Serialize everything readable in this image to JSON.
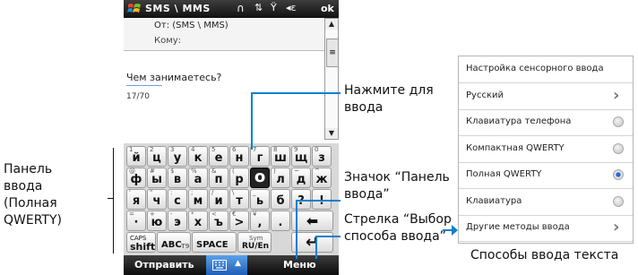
{
  "statusbar": {
    "title": "SMS \\ MMS",
    "ok": "ok"
  },
  "header": {
    "from": "От: (SMS \\ MMS)",
    "to": "Кому:"
  },
  "message": {
    "text": "Чем занимаетесь?",
    "counter": "17/70"
  },
  "keyboard": {
    "rows": [
      [
        {
          "s": "1",
          "m": "й"
        },
        {
          "s": "2",
          "m": "ц"
        },
        {
          "s": "3",
          "m": "у"
        },
        {
          "s": "4",
          "m": "к"
        },
        {
          "s": "5",
          "m": "е"
        },
        {
          "s": "6",
          "m": "н"
        },
        {
          "s": "7",
          "m": "г"
        },
        {
          "s": "8",
          "m": "ш"
        },
        {
          "s": "9",
          "m": "щ"
        },
        {
          "s": "0",
          "m": "з"
        }
      ],
      [
        {
          "s": "@",
          "m": "ф"
        },
        {
          "s": "#",
          "m": "ы"
        },
        {
          "s": "$",
          "m": "в"
        },
        {
          "s": "%",
          "m": "а"
        },
        {
          "s": "&",
          "m": "п"
        },
        {
          "s": "(",
          "m": "р"
        },
        {
          "s": "",
          "m": "о"
        },
        {
          "s": ")",
          "m": "л"
        },
        {
          "s": "~",
          "m": "д"
        },
        {
          "s": "^",
          "m": "ж"
        }
      ],
      [
        {
          "s": "'",
          "m": "я"
        },
        {
          "s": "\"",
          "m": "ч"
        },
        {
          "s": ":",
          "m": "с"
        },
        {
          "s": ";",
          "m": "м"
        },
        {
          "s": "/",
          "m": "и"
        },
        {
          "s": "\\",
          "m": "т"
        },
        {
          "s": "_",
          "m": "ь"
        },
        {
          "s": "",
          "m": "б"
        },
        {
          "s": "",
          "m": "?"
        },
        {
          "s": "",
          "m": "!"
        }
      ],
      [
        {
          "s": "=",
          "m": "·"
        },
        {
          "s": "+",
          "m": "ю"
        },
        {
          "s": "-",
          "m": "э"
        },
        {
          "s": "*",
          "m": "х"
        },
        {
          "s": "<",
          "m": "ъ"
        },
        {
          "s": "€",
          "m": ">"
        },
        {
          "s": "¥",
          "m": ","
        },
        {
          "s": "",
          "m": "."
        }
      ]
    ],
    "caps": "CAPS",
    "shift": "shift",
    "abc": "ABC",
    "t9": "T9",
    "space": "SPACE",
    "sym": "Sym",
    "lang": "RU/En",
    "center_key": "о"
  },
  "softkeys": {
    "left": "Отправить",
    "right": "Меню"
  },
  "annotations": {
    "panel_label": "Панель ввода (Полная QWERTY)",
    "press_hint": "Нажмите для ввода",
    "icon_label": "Значок “Панель ввода”",
    "arrow_label": "Стрелка “Выбор способа ввода”",
    "methods_caption": "Способы ввода текста"
  },
  "menu": {
    "items": [
      {
        "label": "Настройка сенсорного ввода",
        "indicator": "none"
      },
      {
        "label": "Русский",
        "indicator": "chevron"
      },
      {
        "label": "Клавиатура телефона",
        "indicator": "radio"
      },
      {
        "label": "Компактная QWERTY",
        "indicator": "radio"
      },
      {
        "label": "Полная QWERTY",
        "indicator": "radio-selected"
      },
      {
        "label": "Клавиатура",
        "indicator": "radio"
      },
      {
        "label": "Другие методы ввода",
        "indicator": "chevron"
      }
    ]
  },
  "colors": {
    "accent": "#0e7fd0",
    "selected_radio": "#2466d8"
  }
}
